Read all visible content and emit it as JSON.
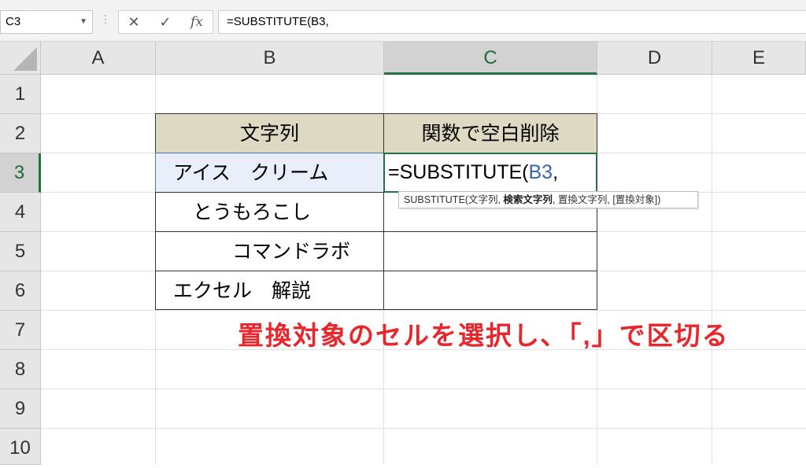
{
  "formula_bar": {
    "name_box": "C3",
    "cancel_icon": "✕",
    "enter_icon": "✓",
    "fx_label": "fx",
    "formula": "=SUBSTITUTE(B3,"
  },
  "columns": [
    "A",
    "B",
    "C",
    "D",
    "E"
  ],
  "active_column": "C",
  "rows": [
    "1",
    "2",
    "3",
    "4",
    "5",
    "6",
    "7",
    "8",
    "9",
    "10"
  ],
  "active_row": "3",
  "table": {
    "header_b": "文字列",
    "header_c": "関数で空白削除",
    "b_values": [
      "アイス　クリーム",
      "　とうもろこし",
      "　　　コマンドラボ",
      "エクセル　解説"
    ],
    "c3_prefix": "=SUBSTITUTE(",
    "c3_ref": "B3",
    "c3_suffix": ","
  },
  "tooltip": {
    "func": "SUBSTITUTE(",
    "arg1": "文字列, ",
    "arg2_bold": "検索文字列",
    "rest": ", 置換文字列, [置換対象])"
  },
  "annotation": "置換対象のセルを選択し､「,」で区切る",
  "colors": {
    "header_fill": "#ddd9c3",
    "ref_blue": "#3a66b0",
    "annotation_red": "#e8272c",
    "excel_green": "#217346"
  }
}
